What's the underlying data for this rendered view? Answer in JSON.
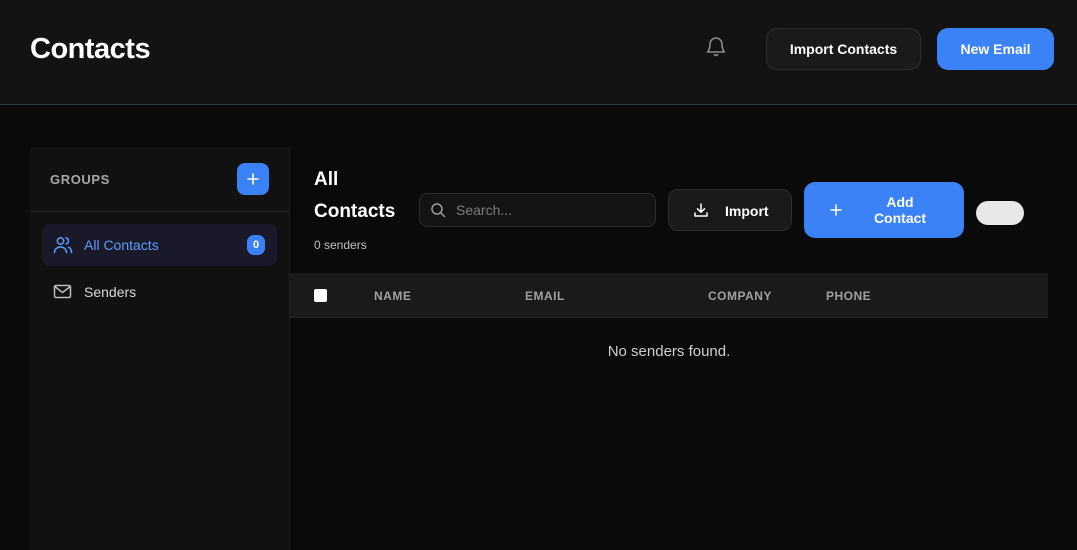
{
  "header": {
    "title": "Contacts",
    "notifications_icon": "bell-icon",
    "import_contacts_label": "Import Contacts",
    "new_email_label": "New Email"
  },
  "sidebar": {
    "groups_label": "GROUPS",
    "add_group_icon": "plus-icon",
    "items": [
      {
        "label": "All Contacts",
        "icon": "users-icon",
        "count": "0",
        "active": true
      },
      {
        "label": "Senders",
        "icon": "mail-icon",
        "active": false
      }
    ]
  },
  "main": {
    "title_line1": "All",
    "title_line2": "Contacts",
    "sender_count": "0 senders",
    "search": {
      "placeholder": "Search...",
      "value": ""
    },
    "import_label": "Import",
    "add_contact_line1": "Add",
    "add_contact_line2": "Contact",
    "table": {
      "columns": [
        "NAME",
        "EMAIL",
        "COMPANY",
        "PHONE"
      ],
      "rows": [],
      "empty_message": "No senders found."
    }
  },
  "colors": {
    "accent": "#3b82f6",
    "background": "#0a0a0a",
    "header_bg": "#131313",
    "active_text": "#5b9cf7"
  }
}
